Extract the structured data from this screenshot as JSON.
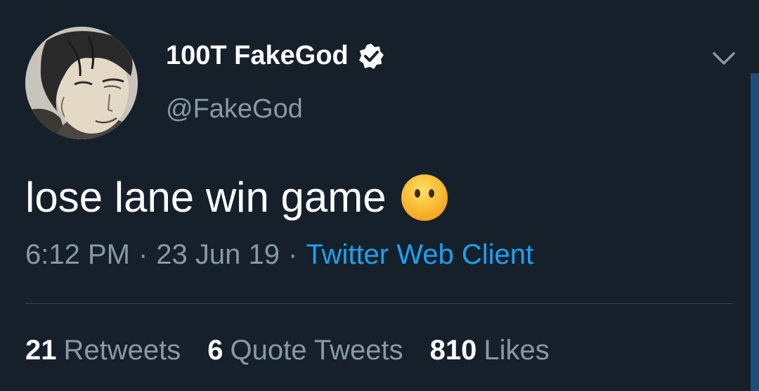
{
  "tweet": {
    "author": {
      "display_name": "100T FakeGod",
      "handle": "@FakeGod",
      "verified": true
    },
    "text": "lose lane win game",
    "emoji": "face-without-mouth",
    "time": "6:12 PM",
    "separator": "·",
    "date": "23 Jun 19",
    "source": "Twitter Web Client",
    "stats": {
      "retweets_count": "21",
      "retweets_label": "Retweets",
      "quotes_count": "6",
      "quotes_label": "Quote Tweets",
      "likes_count": "810",
      "likes_label": "Likes"
    }
  },
  "colors": {
    "background": "#15202b",
    "text_primary": "#ffffff",
    "text_secondary": "#8899a6",
    "link": "#1da1f2",
    "divider": "#38444d"
  }
}
